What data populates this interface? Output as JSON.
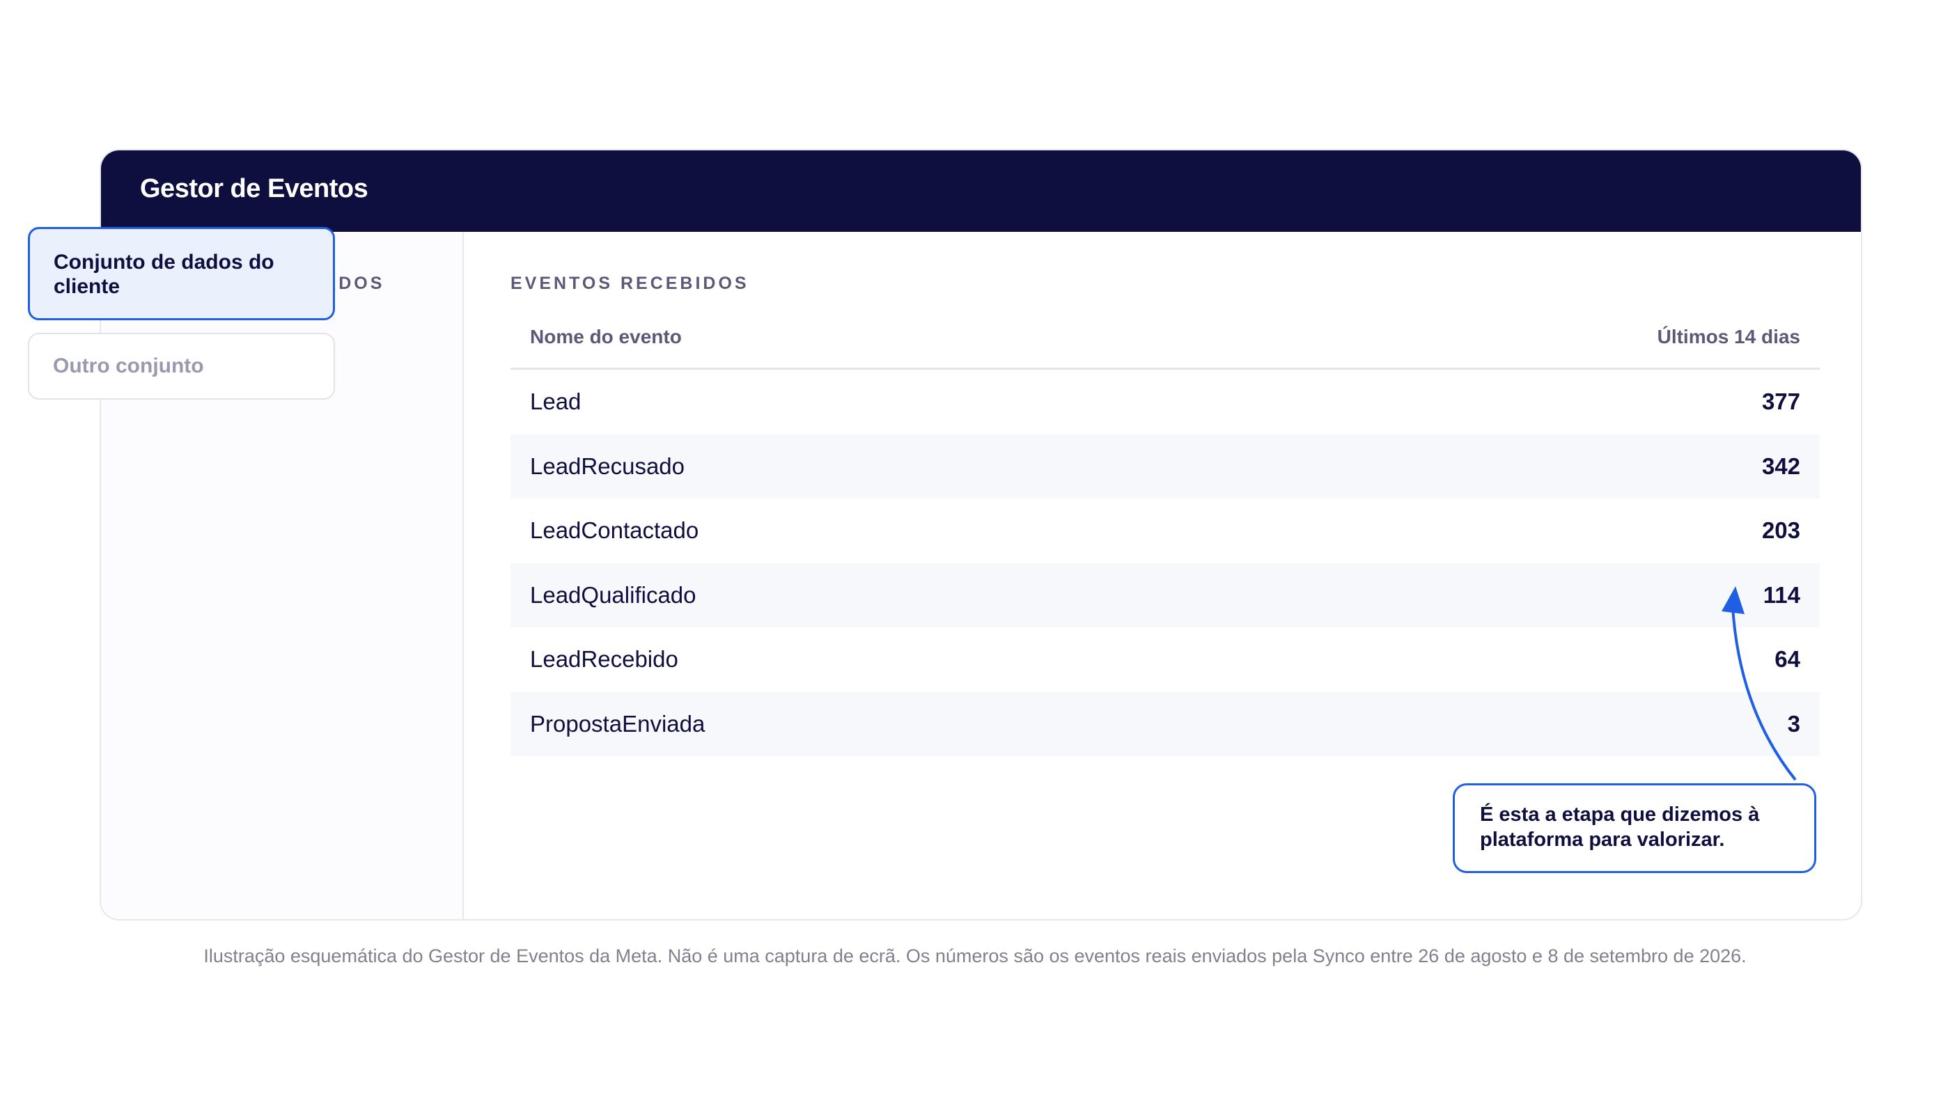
{
  "panel": {
    "title": "Gestor de Eventos"
  },
  "sidebar": {
    "section_label": "CONJUNTOS DE DADOS",
    "items": [
      {
        "label": "Conjunto de dados do cliente",
        "state": "selected"
      },
      {
        "label": "Outro conjunto",
        "state": "unselected"
      }
    ]
  },
  "main": {
    "section_label": "EVENTOS RECEBIDOS",
    "columns": {
      "name": "Nome do evento",
      "count": "Últimos 14 dias"
    },
    "rows": [
      {
        "name": "Lead",
        "count": "377"
      },
      {
        "name": "LeadRecusado",
        "count": "342"
      },
      {
        "name": "LeadContactado",
        "count": "203"
      },
      {
        "name": "LeadQualificado",
        "count": "114"
      },
      {
        "name": "LeadRecebido",
        "count": "64"
      },
      {
        "name": "PropostaEnviada",
        "count": "3"
      }
    ]
  },
  "callout": {
    "text": "É esta a etapa que dizemos à plataforma para valorizar.",
    "target_row": "LeadQualificado"
  },
  "caption": "Ilustração esquemática do Gestor de Eventos da Meta. Não é uma captura de ecrã. Os números são os eventos reais enviados pela Synco entre 26 de agosto e 8 de setembro de 2026.",
  "colors": {
    "header_bg": "#0f0f3f",
    "accent": "#1f5fe3",
    "selected_bg": "#eaf1fd"
  }
}
